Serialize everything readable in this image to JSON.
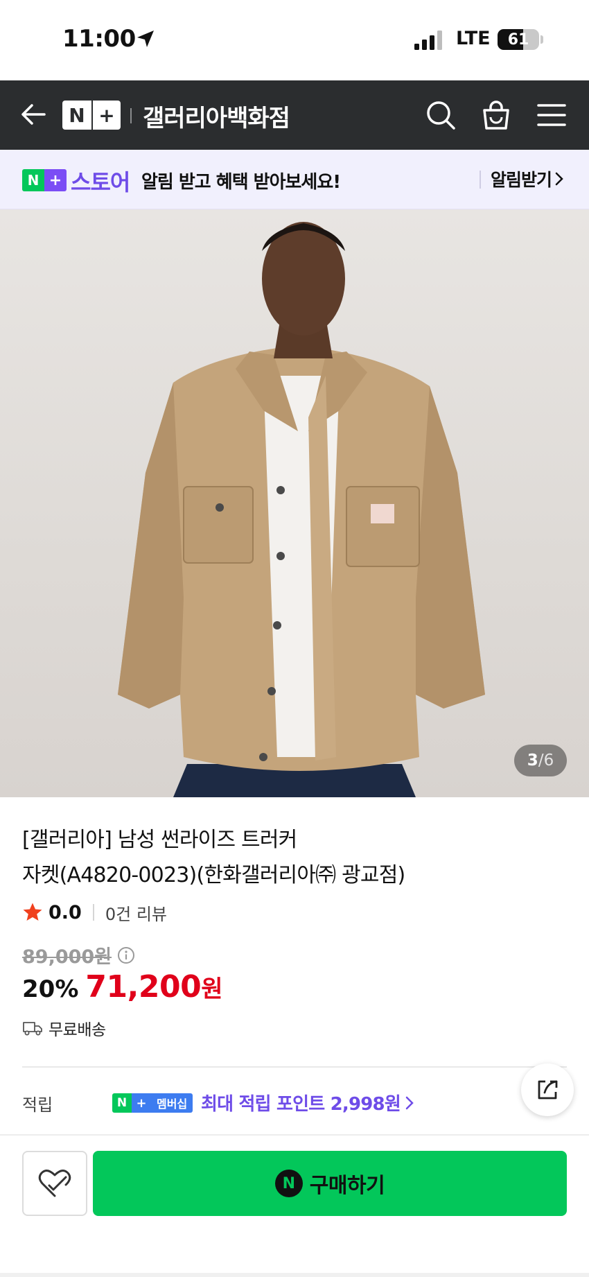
{
  "status_bar": {
    "time": "11:00",
    "network": "LTE",
    "battery_level": 61,
    "battery_label": "61"
  },
  "header": {
    "logo_n": "N",
    "logo_plus": "+",
    "store_name": "갤러리아백화점",
    "icons": [
      "back-arrow-icon",
      "search-icon",
      "shopping-bag-icon",
      "menu-icon"
    ]
  },
  "notification": {
    "logo_n": "N",
    "logo_plus": "+",
    "store_label": "스토어",
    "message": "알림 받고 혜택 받아보세요!",
    "cta": "알림받기"
  },
  "gallery": {
    "current": "3",
    "separator": "/",
    "total": "6"
  },
  "product": {
    "title_line1": "[갤러리아] 남성 썬라이즈 트러커",
    "title_line2": "자켓(A4820-0023)(한화갤러리아㈜ 광교점)",
    "rating_score": "0.0",
    "review_count": "0건 리뷰",
    "original_price": "89,000원",
    "discount_rate": "20%",
    "sale_price": "71,200",
    "currency": "원",
    "shipping": "무료배송"
  },
  "points": {
    "label": "적립",
    "badge_n": "N",
    "badge_plus": "+",
    "badge_membership": "멤버십",
    "text": "최대 적립 포인트 2,998원"
  },
  "bottom_bar": {
    "buy_logo": "N",
    "buy_label": "구매하기"
  },
  "colors": {
    "header_bg": "#2b2d2f",
    "naver_green": "#03c75a",
    "plus_purple": "#6e4ce8",
    "sale_red": "#e0001a"
  }
}
